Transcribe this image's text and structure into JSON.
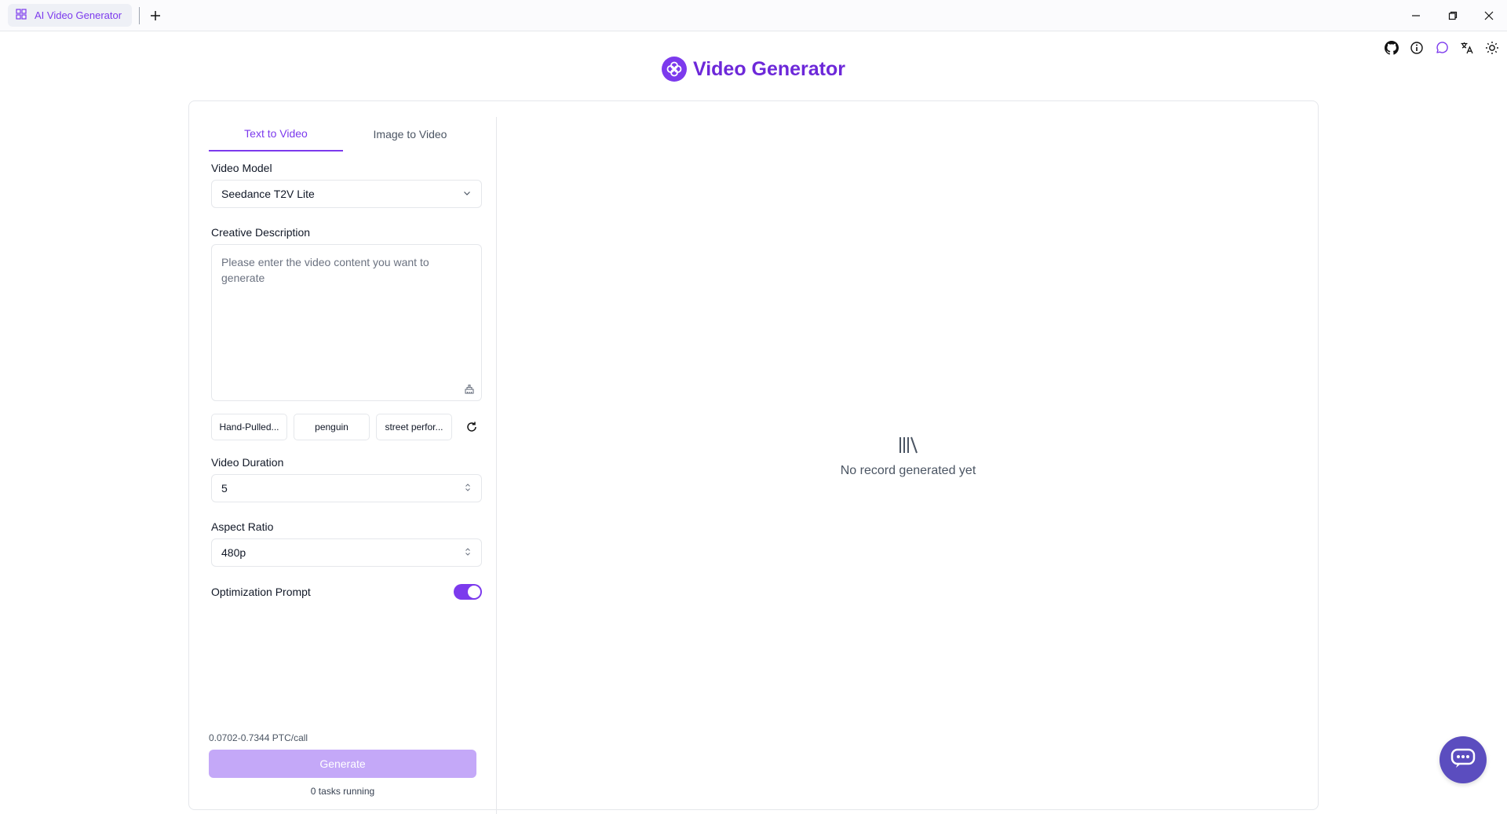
{
  "window": {
    "tab_title": "AI Video Generator"
  },
  "header": {
    "title": "Video Generator"
  },
  "tabs": [
    {
      "label": "Text to Video",
      "active": true
    },
    {
      "label": "Image to Video",
      "active": false
    }
  ],
  "form": {
    "video_model_label": "Video Model",
    "video_model_value": "Seedance T2V Lite",
    "creative_label": "Creative Description",
    "creative_placeholder": "Please enter the video content you want to generate",
    "suggestions": [
      "Hand-Pulled...",
      "penguin",
      "street perfor..."
    ],
    "duration_label": "Video Duration",
    "duration_value": "5",
    "aspect_label": "Aspect Ratio",
    "aspect_value": "480p",
    "optimization_label": "Optimization Prompt",
    "optimization_enabled": true
  },
  "footer": {
    "price": "0.0702-0.7344 PTC/call",
    "generate_label": "Generate",
    "tasks_running": "0 tasks running"
  },
  "empty_state": {
    "text": "No record generated yet",
    "icon": "library-icon"
  },
  "toolbar_icons": [
    "github-icon",
    "info-icon",
    "chat-icon",
    "translate-icon",
    "sun-icon"
  ],
  "colors": {
    "accent": "#7c3aed",
    "button_disabled": "#c4a8f8",
    "chatbot": "#5b4dbf"
  }
}
